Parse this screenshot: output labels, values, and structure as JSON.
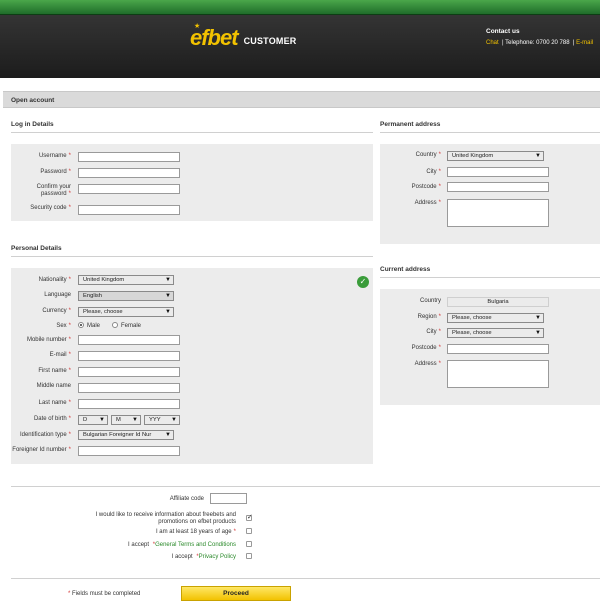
{
  "header": {
    "brand": "efbet",
    "brand_sub": "CUSTOMER",
    "contact_title": "Contact us",
    "chat": "Chat",
    "separator": "|",
    "telephone": "Telephone: 0700 20 788",
    "email": "E-mail"
  },
  "page": {
    "section_title": "Open account"
  },
  "login": {
    "title": "Log in Details",
    "username": "Username",
    "password": "Password",
    "confirm_password_1": "Confirm your",
    "confirm_password_2": "password",
    "security_code": "Security code"
  },
  "permanent": {
    "title": "Permanent address",
    "country_label": "Country",
    "country_value": "United Kingdom",
    "city": "City",
    "postcode": "Postcode",
    "address": "Address"
  },
  "personal": {
    "title": "Personal Details",
    "nationality_label": "Nationality",
    "nationality_value": "United Kingdom",
    "language_label": "Language",
    "language_value": "English",
    "currency_label": "Currency",
    "currency_value": "Please, choose",
    "sex_label": "Sex",
    "sex_male": "Male",
    "sex_female": "Female",
    "mobile": "Mobile number",
    "email": "E-mail",
    "first_name": "First name",
    "middle_name": "Middle name",
    "last_name": "Last name",
    "dob_label": "Date of birth",
    "dob_day": "D",
    "dob_month": "M",
    "dob_year": "YYY",
    "id_type_label": "Identification type",
    "id_type_value": "Bulgarian Foreigner Id Nur",
    "foreigner_id": "Foreigner Id number"
  },
  "current": {
    "title": "Current address",
    "country_label": "Country",
    "country_value": "Bulgaria",
    "region_label": "Region",
    "region_value": "Please, choose",
    "city_label": "City",
    "city_value": "Please, choose",
    "postcode": "Postcode",
    "address": "Address"
  },
  "consent": {
    "affiliate_code": "Affiliate code",
    "freebets_1": "I would like to receive information about freebets and",
    "freebets_2": "promotions on efbet products",
    "age": "I am at least 18 years of age",
    "terms_prefix": "I accept",
    "terms_link": "General Terms and Conditions",
    "privacy_prefix": "I accept",
    "privacy_link": "Privacy Policy"
  },
  "footer": {
    "required_note": "Fields must be completed",
    "proceed": "Proceed"
  },
  "required_mark": "*",
  "colors": {
    "brand_yellow": "#f2c200",
    "header_green": "#2e8a36",
    "required_red": "#d43030",
    "link_green": "#2b8a2b"
  }
}
